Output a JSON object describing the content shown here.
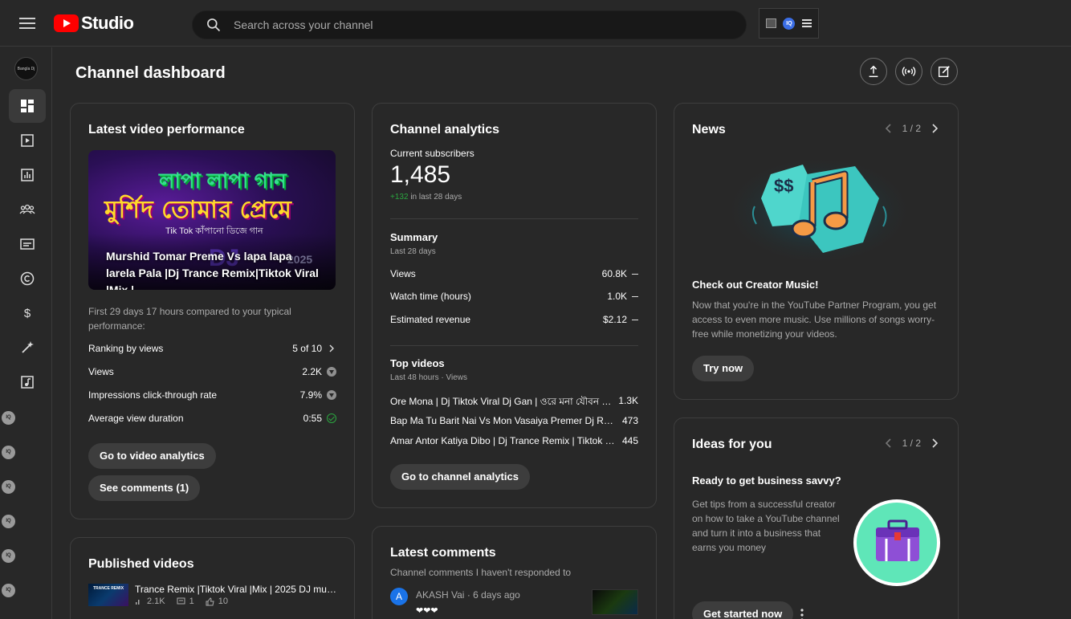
{
  "app": {
    "studio_label": "Studio"
  },
  "search": {
    "placeholder": "Search across your channel"
  },
  "page": {
    "title": "Channel dashboard"
  },
  "latest_video": {
    "heading": "Latest video performance",
    "thumb_bengali_1": "লাপা লাপা গান",
    "thumb_bengali_2": "মুর্শিদ তোমার প্রেমে",
    "thumb_bengali_3": "Tik Tok কাঁপানো ডিজে গান",
    "thumb_dj": "DJ",
    "thumb_year": "2025",
    "video_title": "Murshid Tomar Preme Vs lapa lapa larela Pala |Dj Trance Remix|Tiktok Viral |Mix |...",
    "compare_text": "First 29 days 17 hours compared to your typical performance:",
    "stats": [
      {
        "label": "Ranking by views",
        "value": "5 of 10"
      },
      {
        "label": "Views",
        "value": "2.2K"
      },
      {
        "label": "Impressions click-through rate",
        "value": "7.9%"
      },
      {
        "label": "Average view duration",
        "value": "0:55"
      }
    ],
    "btn_analytics": "Go to video analytics",
    "btn_comments": "See comments (1)"
  },
  "published": {
    "heading": "Published videos",
    "items": [
      {
        "title": "Trance Remix |Tiktok Viral |Mix | 2025 DJ musi...",
        "views": "2.1K",
        "comments": "1",
        "likes": "10",
        "thumb_text": "TRANCE REMIX"
      }
    ]
  },
  "analytics": {
    "heading": "Channel analytics",
    "subs_label": "Current subscribers",
    "subs_value": "1,485",
    "subs_delta": "+132",
    "subs_delta_suffix": "in last 28 days",
    "summary_heading": "Summary",
    "summary_period": "Last 28 days",
    "summary": [
      {
        "label": "Views",
        "value": "60.8K"
      },
      {
        "label": "Watch time (hours)",
        "value": "1.0K"
      },
      {
        "label": "Estimated revenue",
        "value": "$2.12"
      }
    ],
    "top_heading": "Top videos",
    "top_period": "Last 48 hours · Views",
    "top_videos": [
      {
        "title": "Ore Mona | Dj Tiktok Viral Dj Gan | ওরে মনা যৌবন টা ...",
        "views": "1.3K"
      },
      {
        "title": "Bap Ma Tu Barit Nai Vs Mon Vasaiya Premer Dj Rem...",
        "views": "473"
      },
      {
        "title": "Amar Antor Katiya Dibo | Dj Trance Remix | Tiktok Vi...",
        "views": "445"
      }
    ],
    "btn": "Go to channel analytics"
  },
  "comments": {
    "heading": "Latest comments",
    "subtitle": "Channel comments I haven't responded to",
    "items": [
      {
        "initial": "A",
        "author": "AKASH Vai",
        "time": "· 6 days ago",
        "text": "❤❤❤"
      }
    ]
  },
  "news": {
    "heading": "News",
    "pager": "1 / 2",
    "title": "Check out Creator Music!",
    "body": "Now that you're in the YouTube Partner Program, you get access to even more music. Use millions of songs worry-free while monetizing your videos.",
    "btn": "Try now",
    "dollar_glyph": "$$"
  },
  "ideas": {
    "heading": "Ideas for you",
    "pager": "1 / 2",
    "title": "Ready to get business savvy?",
    "body": "Get tips from a successful creator on how to take a YouTube channel and turn it into a business that earns you money",
    "btn": "Get started now"
  },
  "sidebar": {
    "badge_text": "IQ",
    "avatar_text": "Bangla Dj"
  },
  "colors": {
    "accent_red": "#ff0000",
    "positive_green": "#2ba640",
    "card_bg": "#282828"
  }
}
